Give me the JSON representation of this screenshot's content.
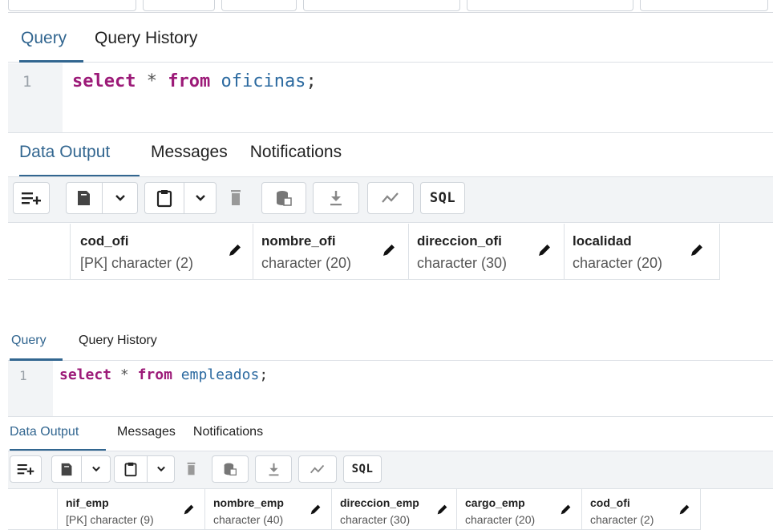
{
  "panel1": {
    "tabs": [
      "Query",
      "Query History"
    ],
    "line_number": "1",
    "sql": {
      "kw1": "select",
      "star": "*",
      "kw2": "from",
      "table": "oficinas",
      "end": ";"
    },
    "output_tabs": [
      "Data Output",
      "Messages",
      "Notifications"
    ],
    "toolbar": {
      "sql_label": "SQL"
    },
    "columns": [
      {
        "name": "cod_ofi",
        "type": "[PK] character (2)"
      },
      {
        "name": "nombre_ofi",
        "type": "character (20)"
      },
      {
        "name": "direccion_ofi",
        "type": "character (30)"
      },
      {
        "name": "localidad",
        "type": "character (20)"
      }
    ]
  },
  "panel2": {
    "tabs": [
      "Query",
      "Query History"
    ],
    "line_number": "1",
    "sql": {
      "kw1": "select",
      "star": "*",
      "kw2": "from",
      "table": "empleados",
      "end": ";"
    },
    "output_tabs": [
      "Data Output",
      "Messages",
      "Notifications"
    ],
    "toolbar": {
      "sql_label": "SQL"
    },
    "columns": [
      {
        "name": "nif_emp",
        "type": "[PK] character (9)"
      },
      {
        "name": "nombre_emp",
        "type": "character (40)"
      },
      {
        "name": "direccion_emp",
        "type": "character (30)"
      },
      {
        "name": "cargo_emp",
        "type": "character (20)"
      },
      {
        "name": "cod_ofi",
        "type": "character (2)"
      }
    ]
  },
  "icons": [
    "add-row-icon",
    "copy-icon",
    "chevron-down-icon",
    "paste-icon",
    "delete-icon",
    "save-data-icon",
    "download-icon",
    "graph-icon",
    "sql-icon",
    "edit-pencil-icon"
  ],
  "colors": {
    "accent": "#326690",
    "keyword": "#9c1a78",
    "identifier": "#2c6aa0"
  }
}
